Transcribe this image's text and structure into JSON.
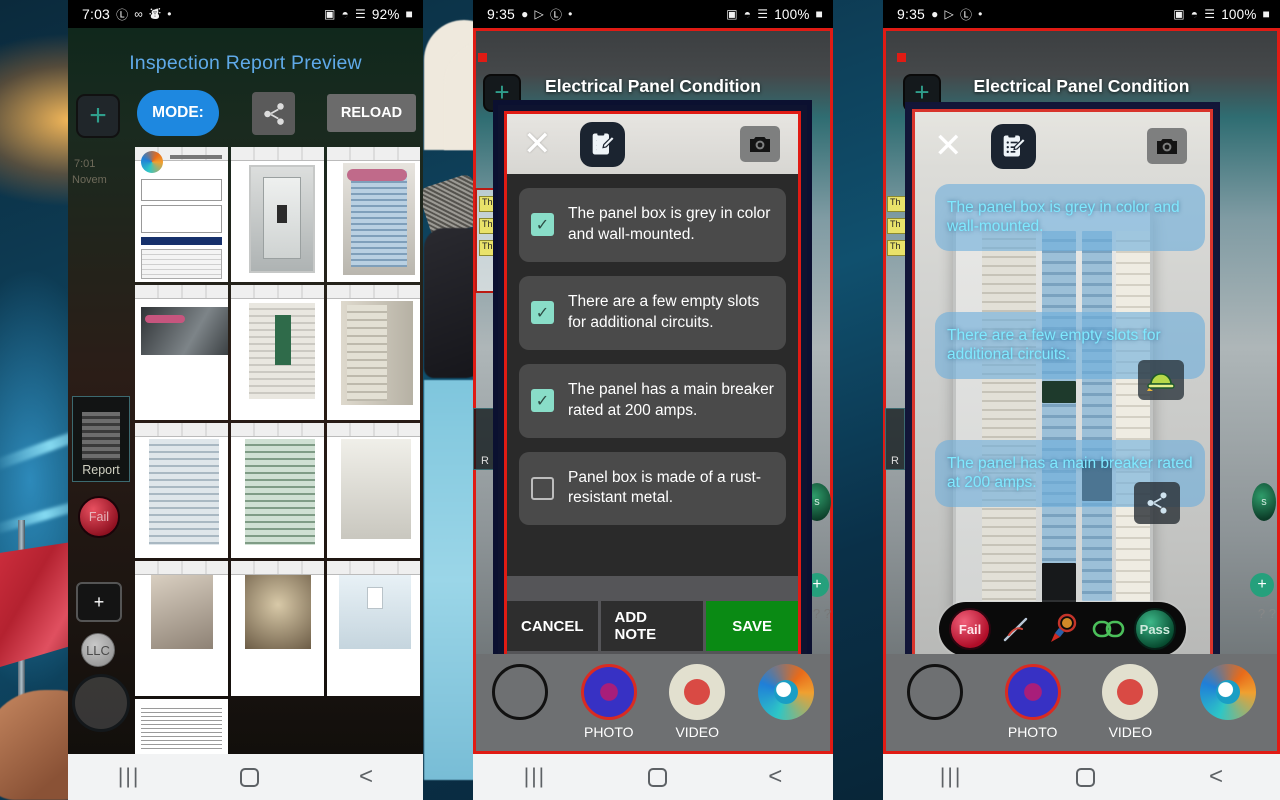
{
  "panel1": {
    "status": {
      "time": "7:03",
      "icons": [
        "gmail-icon",
        "voicemail-icon",
        "contact-icon",
        "dot-icon"
      ],
      "battery": "92%"
    },
    "title": "Inspection Report Preview",
    "buttons": {
      "mode": "MODE:",
      "share": "share-icon",
      "reload": "RELOAD"
    },
    "rail": {
      "add": "+",
      "time_small": "7:01",
      "date_small": "Novem",
      "report": "Report",
      "fail": "Fail",
      "folder": "+",
      "seal": "LLC"
    },
    "nav": {
      "recents": "|||",
      "home": "home-icon",
      "back": "<"
    }
  },
  "panel2": {
    "status": {
      "time": "9:35",
      "icons": [
        "messenger-icon",
        "play-store-icon",
        "gmail-icon",
        "dot-icon"
      ],
      "battery": "100%"
    },
    "header": "Electrical Panel Condition",
    "chips": [
      "Th",
      "Th",
      "Th"
    ],
    "report_mini": "R",
    "right_pass": "s",
    "right_q": "? ?",
    "modal": {
      "close": "✕",
      "clipboard_icon": "clipboard-edit-icon",
      "camera_icon": "camera-icon",
      "items": [
        {
          "checked": true,
          "text": "The panel box is grey in color and wall-mounted."
        },
        {
          "checked": true,
          "text": "There are a few empty slots for additional circuits."
        },
        {
          "checked": true,
          "text": "The panel has a main breaker rated at 200 amps."
        },
        {
          "checked": false,
          "text": "Panel box is made of a rust-resistant metal."
        }
      ],
      "actions": {
        "cancel": "CANCEL",
        "add_note": "ADD NOTE",
        "save": "SAVE"
      }
    },
    "bottombar": [
      {
        "label": "",
        "icon": "shutter-ring-icon"
      },
      {
        "label": "PHOTO",
        "icon": "photo-mode-icon"
      },
      {
        "label": "VIDEO",
        "icon": "video-mode-icon"
      },
      {
        "label": "",
        "icon": "firefox-icon"
      }
    ],
    "nav": {
      "recents": "|||",
      "home": "home-icon",
      "back": "<"
    }
  },
  "panel3": {
    "status": {
      "time": "9:35",
      "icons": [
        "messenger-icon",
        "play-store-icon",
        "gmail-icon",
        "dot-icon"
      ],
      "battery": "100%"
    },
    "header": "Electrical Panel Condition",
    "topbar": {
      "close": "✕",
      "clipboard_icon": "clipboard-edit-icon",
      "camera_icon": "camera-icon"
    },
    "annotations": [
      "The panel box is grey in color and wall-mounted.",
      "There are a few empty slots for additional circuits.",
      "The panel has a main breaker rated at 200 amps."
    ],
    "overlay_icons": [
      "hard-hat-icon",
      "share-icon"
    ],
    "toolbar": {
      "fail": "Fail",
      "pass": "Pass",
      "icons": [
        "pencil-icon",
        "marker-icon",
        "chain-link-icon"
      ]
    },
    "chips": [
      "Th",
      "Th",
      "Th"
    ],
    "report_mini": "R",
    "right_pass": "s",
    "right_q": "? ?",
    "bottombar": [
      {
        "label": "",
        "icon": "shutter-ring-icon"
      },
      {
        "label": "PHOTO",
        "icon": "photo-mode-icon"
      },
      {
        "label": "VIDEO",
        "icon": "video-mode-icon"
      },
      {
        "label": "",
        "icon": "firefox-icon"
      }
    ],
    "nav": {
      "recents": "|||",
      "home": "home-icon",
      "back": "<"
    }
  },
  "colors": {
    "accent_blue": "#1e88e0",
    "title_blue": "#5fa9e8",
    "frame_red": "#e01b14",
    "save_green": "#0a8a14",
    "check_mint": "#89ddc8",
    "annotation_cyan": "#7fe9ff"
  }
}
